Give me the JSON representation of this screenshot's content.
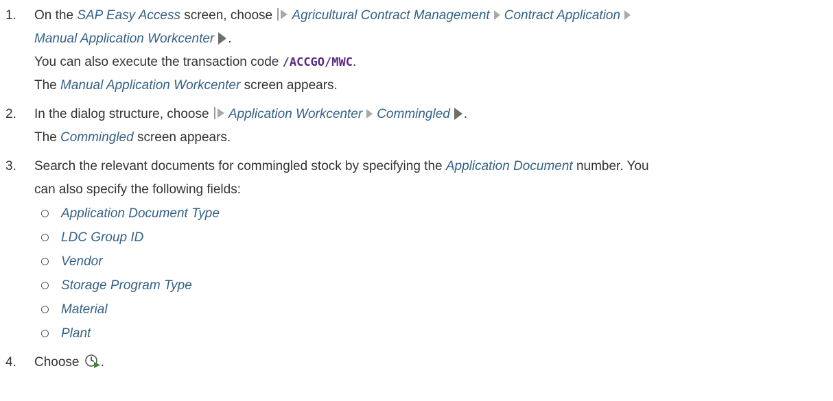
{
  "steps": [
    {
      "number": "1.",
      "segments": {
        "intro": "On the ",
        "screen_name": "SAP Easy Access",
        "mid": " screen, choose ",
        "path": [
          "Agricultural Contract Management",
          "Contract Application",
          "Manual Application Workcenter"
        ],
        "end": ".",
        "transaction_pre": "You can also execute the transaction code ",
        "transaction_code": "/ACCGO/MWC",
        "transaction_post": ".",
        "result_pre": "The ",
        "result_screen": "Manual Application Workcenter",
        "result_post": " screen appears."
      }
    },
    {
      "number": "2.",
      "segments": {
        "intro": "In the dialog structure, choose ",
        "path": [
          "Application Workcenter",
          "Commingled"
        ],
        "end": ".",
        "result_pre": "The ",
        "result_screen": "Commingled",
        "result_post": " screen appears."
      }
    },
    {
      "number": "3.",
      "segments": {
        "intro": "Search the relevant documents for commingled stock by specifying the ",
        "field": "Application Document",
        "post": " number. You",
        "line2": "can also specify the following fields:",
        "fields": [
          "Application Document Type",
          "LDC Group ID",
          "Vendor",
          "Storage Program Type",
          "Material",
          "Plant"
        ]
      }
    },
    {
      "number": "4.",
      "segments": {
        "intro": "Choose ",
        "icon": "execute-clock-icon",
        "end": "."
      }
    }
  ],
  "colors": {
    "text": "#333333",
    "ui_term": "#346187",
    "code": "#5a2a82"
  }
}
